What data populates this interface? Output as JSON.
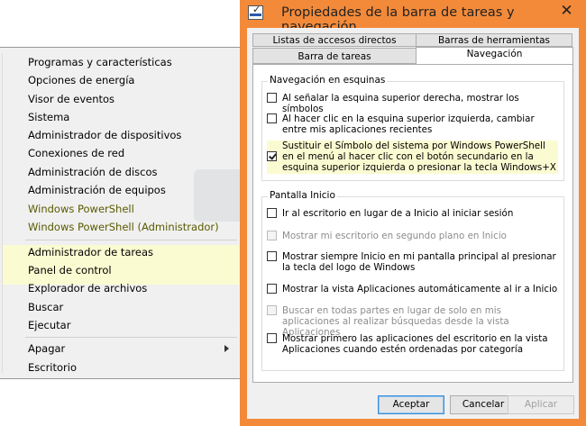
{
  "context_menu": {
    "items_top": [
      "Programas y características",
      "Opciones de energía",
      "Visor de eventos",
      "Sistema",
      "Administrador de dispositivos",
      "Conexiones de red",
      "Administración de discos",
      "Administración de equipos",
      "Windows PowerShell",
      "Windows PowerShell (Administrador)"
    ],
    "items_mid": [
      "Administrador de tareas",
      "Panel de control",
      "Explorador de archivos",
      "Buscar",
      "Ejecutar"
    ],
    "items_bottom": [
      "Apagar",
      "Escritorio"
    ]
  },
  "dialog": {
    "title": "Propiedades de la barra de tareas y navegación",
    "close_glyph": "✕",
    "app_icon_check": "✓",
    "tabs_row1": [
      "Listas de accesos directos",
      "Barras de herramientas"
    ],
    "tabs_row2": [
      "Barra de tareas",
      "Navegación"
    ],
    "corners_group": {
      "title": "Navegación en esquinas",
      "options": [
        {
          "label": "Al señalar la esquina superior derecha, mostrar los símbolos",
          "checked": false,
          "disabled": false
        },
        {
          "label": "Al hacer clic en la esquina superior izquierda, cambiar entre mis aplicaciones recientes",
          "checked": false,
          "disabled": false
        },
        {
          "label": "Sustituir el Símbolo del sistema por Windows PowerShell en el menú al hacer clic con el botón secundario en la esquina superior izquierda o presionar la tecla Windows+X",
          "checked": true,
          "disabled": false
        }
      ]
    },
    "start_group": {
      "title": "Pantalla Inicio",
      "options": [
        {
          "label": "Ir al escritorio en lugar de a Inicio al iniciar sesión",
          "checked": false,
          "disabled": false
        },
        {
          "label": "Mostrar mi escritorio en segundo plano en Inicio",
          "checked": false,
          "disabled": true
        },
        {
          "label": "Mostrar siempre Inicio en mi pantalla principal al presionar la tecla del logo de Windows",
          "checked": false,
          "disabled": false
        },
        {
          "label": "Mostrar la vista Aplicaciones automáticamente al ir a Inicio",
          "checked": false,
          "disabled": false
        },
        {
          "label": "Buscar en todas partes en lugar de solo en mis aplicaciones al realizar búsquedas desde la vista Aplicaciones",
          "checked": false,
          "disabled": true
        },
        {
          "label": "Mostrar primero las aplicaciones del escritorio en la vista Aplicaciones cuando estén ordenadas por categoría",
          "checked": false,
          "disabled": false
        }
      ]
    },
    "buttons": {
      "accept": "Aceptar",
      "cancel": "Cancelar",
      "apply": "Aplicar"
    }
  }
}
